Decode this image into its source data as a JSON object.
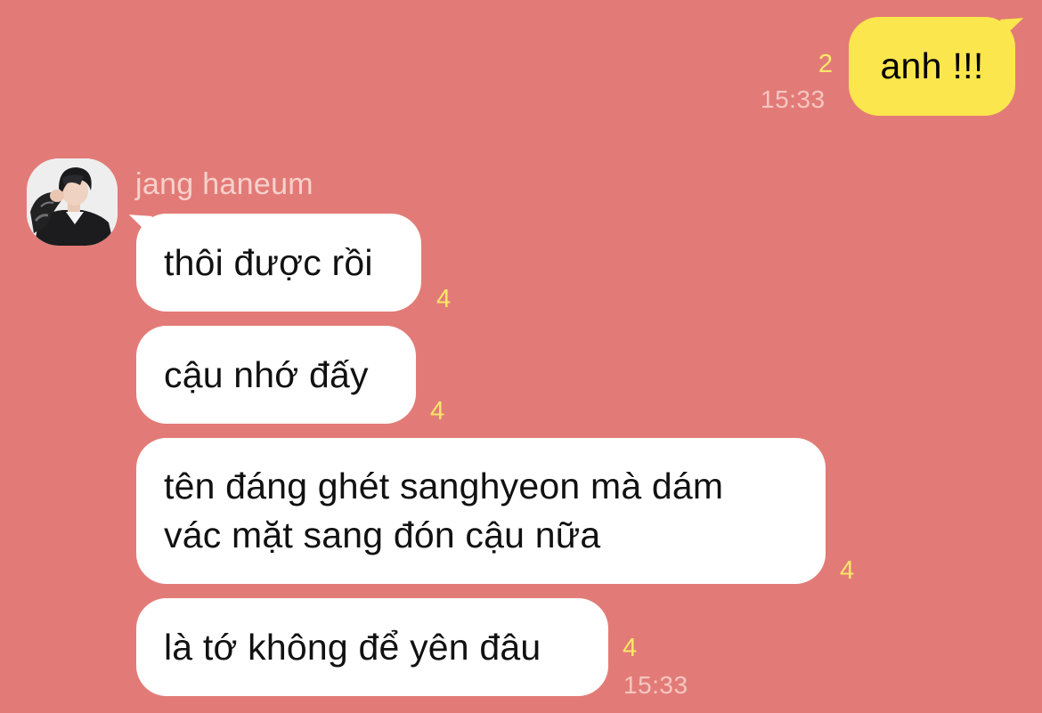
{
  "colors": {
    "background": "#E27B77",
    "outgoing_bubble": "#FBE64D",
    "incoming_bubble": "#FFFFFF",
    "unread_count": "#FCE66A",
    "timestamp": "#F6C6C2"
  },
  "outgoing": {
    "text": "anh !!!",
    "unread": "2",
    "time": "15:33"
  },
  "contact": {
    "name": "jang haneum",
    "avatar_icon": "profile-photo"
  },
  "incoming": [
    {
      "text": "thôi được rồi",
      "unread": "4"
    },
    {
      "text": "cậu nhớ đấy",
      "unread": "4"
    },
    {
      "text": "tên đáng ghét sanghyeon mà dám\nvác mặt sang đón cậu nữa",
      "unread": "4"
    },
    {
      "text": "là tớ không để yên đâu",
      "unread": "4"
    }
  ],
  "incoming_time": "15:33"
}
